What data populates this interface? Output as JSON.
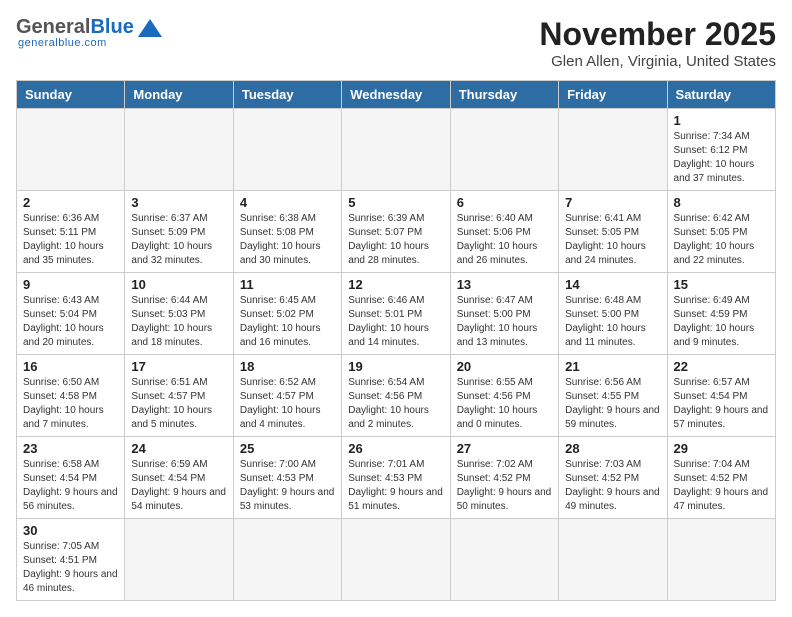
{
  "header": {
    "logo": {
      "general": "General",
      "blue": "Blue",
      "sub": "generalblue.com"
    },
    "title": "November 2025",
    "location": "Glen Allen, Virginia, United States"
  },
  "weekdays": [
    "Sunday",
    "Monday",
    "Tuesday",
    "Wednesday",
    "Thursday",
    "Friday",
    "Saturday"
  ],
  "weeks": [
    [
      {
        "day": "",
        "info": ""
      },
      {
        "day": "",
        "info": ""
      },
      {
        "day": "",
        "info": ""
      },
      {
        "day": "",
        "info": ""
      },
      {
        "day": "",
        "info": ""
      },
      {
        "day": "",
        "info": ""
      },
      {
        "day": "1",
        "info": "Sunrise: 7:34 AM\nSunset: 6:12 PM\nDaylight: 10 hours and 37 minutes."
      }
    ],
    [
      {
        "day": "2",
        "info": "Sunrise: 6:36 AM\nSunset: 5:11 PM\nDaylight: 10 hours and 35 minutes."
      },
      {
        "day": "3",
        "info": "Sunrise: 6:37 AM\nSunset: 5:09 PM\nDaylight: 10 hours and 32 minutes."
      },
      {
        "day": "4",
        "info": "Sunrise: 6:38 AM\nSunset: 5:08 PM\nDaylight: 10 hours and 30 minutes."
      },
      {
        "day": "5",
        "info": "Sunrise: 6:39 AM\nSunset: 5:07 PM\nDaylight: 10 hours and 28 minutes."
      },
      {
        "day": "6",
        "info": "Sunrise: 6:40 AM\nSunset: 5:06 PM\nDaylight: 10 hours and 26 minutes."
      },
      {
        "day": "7",
        "info": "Sunrise: 6:41 AM\nSunset: 5:05 PM\nDaylight: 10 hours and 24 minutes."
      },
      {
        "day": "8",
        "info": "Sunrise: 6:42 AM\nSunset: 5:05 PM\nDaylight: 10 hours and 22 minutes."
      }
    ],
    [
      {
        "day": "9",
        "info": "Sunrise: 6:43 AM\nSunset: 5:04 PM\nDaylight: 10 hours and 20 minutes."
      },
      {
        "day": "10",
        "info": "Sunrise: 6:44 AM\nSunset: 5:03 PM\nDaylight: 10 hours and 18 minutes."
      },
      {
        "day": "11",
        "info": "Sunrise: 6:45 AM\nSunset: 5:02 PM\nDaylight: 10 hours and 16 minutes."
      },
      {
        "day": "12",
        "info": "Sunrise: 6:46 AM\nSunset: 5:01 PM\nDaylight: 10 hours and 14 minutes."
      },
      {
        "day": "13",
        "info": "Sunrise: 6:47 AM\nSunset: 5:00 PM\nDaylight: 10 hours and 13 minutes."
      },
      {
        "day": "14",
        "info": "Sunrise: 6:48 AM\nSunset: 5:00 PM\nDaylight: 10 hours and 11 minutes."
      },
      {
        "day": "15",
        "info": "Sunrise: 6:49 AM\nSunset: 4:59 PM\nDaylight: 10 hours and 9 minutes."
      }
    ],
    [
      {
        "day": "16",
        "info": "Sunrise: 6:50 AM\nSunset: 4:58 PM\nDaylight: 10 hours and 7 minutes."
      },
      {
        "day": "17",
        "info": "Sunrise: 6:51 AM\nSunset: 4:57 PM\nDaylight: 10 hours and 5 minutes."
      },
      {
        "day": "18",
        "info": "Sunrise: 6:52 AM\nSunset: 4:57 PM\nDaylight: 10 hours and 4 minutes."
      },
      {
        "day": "19",
        "info": "Sunrise: 6:54 AM\nSunset: 4:56 PM\nDaylight: 10 hours and 2 minutes."
      },
      {
        "day": "20",
        "info": "Sunrise: 6:55 AM\nSunset: 4:56 PM\nDaylight: 10 hours and 0 minutes."
      },
      {
        "day": "21",
        "info": "Sunrise: 6:56 AM\nSunset: 4:55 PM\nDaylight: 9 hours and 59 minutes."
      },
      {
        "day": "22",
        "info": "Sunrise: 6:57 AM\nSunset: 4:54 PM\nDaylight: 9 hours and 57 minutes."
      }
    ],
    [
      {
        "day": "23",
        "info": "Sunrise: 6:58 AM\nSunset: 4:54 PM\nDaylight: 9 hours and 56 minutes."
      },
      {
        "day": "24",
        "info": "Sunrise: 6:59 AM\nSunset: 4:54 PM\nDaylight: 9 hours and 54 minutes."
      },
      {
        "day": "25",
        "info": "Sunrise: 7:00 AM\nSunset: 4:53 PM\nDaylight: 9 hours and 53 minutes."
      },
      {
        "day": "26",
        "info": "Sunrise: 7:01 AM\nSunset: 4:53 PM\nDaylight: 9 hours and 51 minutes."
      },
      {
        "day": "27",
        "info": "Sunrise: 7:02 AM\nSunset: 4:52 PM\nDaylight: 9 hours and 50 minutes."
      },
      {
        "day": "28",
        "info": "Sunrise: 7:03 AM\nSunset: 4:52 PM\nDaylight: 9 hours and 49 minutes."
      },
      {
        "day": "29",
        "info": "Sunrise: 7:04 AM\nSunset: 4:52 PM\nDaylight: 9 hours and 47 minutes."
      }
    ],
    [
      {
        "day": "30",
        "info": "Sunrise: 7:05 AM\nSunset: 4:51 PM\nDaylight: 9 hours and 46 minutes."
      },
      {
        "day": "",
        "info": ""
      },
      {
        "day": "",
        "info": ""
      },
      {
        "day": "",
        "info": ""
      },
      {
        "day": "",
        "info": ""
      },
      {
        "day": "",
        "info": ""
      },
      {
        "day": "",
        "info": ""
      }
    ]
  ]
}
